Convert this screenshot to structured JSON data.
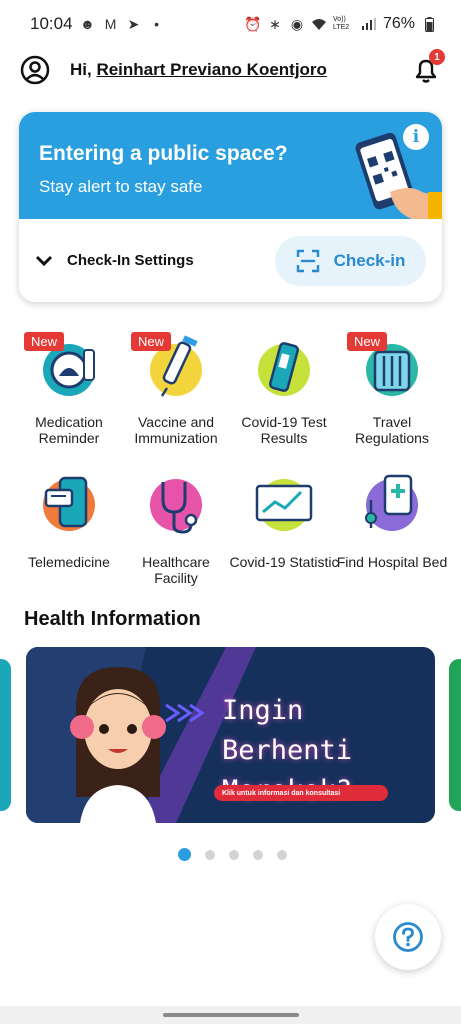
{
  "status_bar": {
    "time": "10:04",
    "battery": "76%",
    "left_icons": [
      "notification-icon",
      "gmail-icon",
      "telegram-icon",
      "dot-icon"
    ],
    "right_icons": [
      "alarm-icon",
      "bluetooth-icon",
      "location-icon",
      "wifi-icon",
      "signal-icon",
      "battery-icon"
    ],
    "volte": "Vo)) LTE2"
  },
  "header": {
    "greeting_prefix": "Hi, ",
    "user_name": "Reinhart Previano Koentjoro",
    "notification_count": "1"
  },
  "checkin_card": {
    "title": "Entering a public space?",
    "subtitle": "Stay alert to stay safe",
    "settings_label": "Check-In Settings",
    "checkin_button": "Check-in",
    "info_glyph": "i"
  },
  "services": [
    {
      "label": "Medication Reminder",
      "new": true,
      "new_label": "New",
      "color": "#1aa7b8"
    },
    {
      "label": "Vaccine and Immunization",
      "new": true,
      "new_label": "New",
      "color": "#f2d43c"
    },
    {
      "label": "Covid-19 Test Results",
      "new": false,
      "color": "#c6e23a"
    },
    {
      "label": "Travel Regulations",
      "new": true,
      "new_label": "New",
      "color": "#2bb7a5"
    },
    {
      "label": "Telemedicine",
      "new": false,
      "color": "#f07a3a"
    },
    {
      "label": "Healthcare Facility",
      "new": false,
      "color": "#e653a9"
    },
    {
      "label": "Covid-19 Statistic",
      "new": false,
      "color": "#c6e23a"
    },
    {
      "label": "Find Hospital Bed",
      "new": false,
      "color": "#8a6bd8"
    }
  ],
  "health_info": {
    "title": "Health Information",
    "banner_line1": "Ingin Berhenti",
    "banner_line2": "Merokok?",
    "banner_cta": "Klik untuk informasi dan konsultasi",
    "page_count": 5,
    "active_page": 1
  },
  "colors": {
    "primary": "#2a9fe0",
    "badge_red": "#e53935",
    "banner_bg": "#15305a"
  }
}
